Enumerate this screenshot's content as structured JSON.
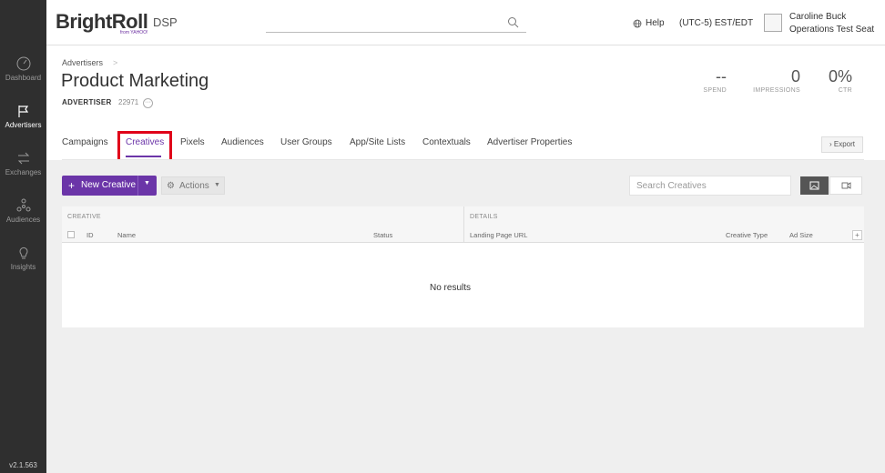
{
  "app": {
    "logo": "BrightRoll",
    "logo_suffix": "DSP",
    "logo_sub": "from YAHOO!"
  },
  "header": {
    "help_label": "Help",
    "timezone": "(UTC-5) EST/EDT",
    "user_name": "Caroline Buck",
    "user_seat": "Operations Test Seat"
  },
  "sidebar": {
    "items": [
      {
        "label": "Dashboard",
        "icon": "gauge-icon"
      },
      {
        "label": "Advertisers",
        "icon": "flag-icon"
      },
      {
        "label": "Exchanges",
        "icon": "arrows-exchange-icon"
      },
      {
        "label": "Audiences",
        "icon": "network-icon"
      },
      {
        "label": "Insights",
        "icon": "lightbulb-icon"
      }
    ],
    "active": "Advertisers",
    "version": "v2.1.563"
  },
  "advertiser": {
    "breadcrumb": "Advertisers",
    "title": "Product Marketing",
    "type_label": "ADVERTISER",
    "id": "22971"
  },
  "stats": {
    "spend_value": "--",
    "spend_label": "SPEND",
    "impressions_value": "0",
    "impressions_label": "IMPRESSIONS",
    "ctr_value": "0%",
    "ctr_label": "CTR"
  },
  "tabs": [
    "Campaigns",
    "Creatives",
    "Pixels",
    "Audiences",
    "User Groups",
    "App/Site Lists",
    "Contextuals",
    "Advertiser Properties"
  ],
  "active_tab": "Creatives",
  "toolbar": {
    "export_label": "Export",
    "new_creative_label": "New Creative",
    "actions_label": "Actions",
    "search_placeholder": "Search Creatives"
  },
  "table": {
    "group_creative": "CREATIVE",
    "group_details": "DETAILS",
    "columns": {
      "id": "ID",
      "name": "Name",
      "status": "Status",
      "landing_page_url": "Landing Page URL",
      "creative_type": "Creative Type",
      "ad_size": "Ad Size"
    },
    "empty_message": "No results"
  },
  "colors": {
    "accent": "#6b35a8",
    "highlight": "#e0001a",
    "sidebar_bg": "#2f2f2f"
  }
}
